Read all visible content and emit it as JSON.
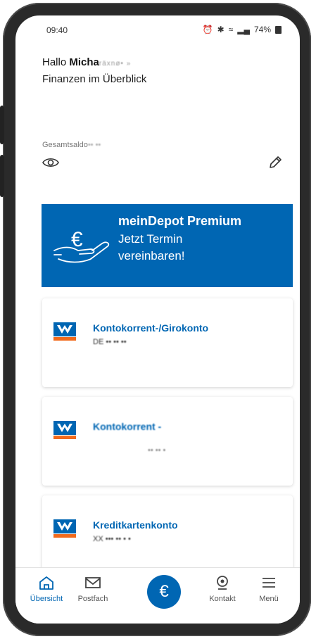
{
  "status": {
    "time": "09:40",
    "battery_pct": "74%"
  },
  "greeting": {
    "prefix": "Hallo",
    "name": "Micha",
    "name_blur": "räxnø• »"
  },
  "subtitle": "Finanzen im Überblick",
  "total": {
    "label": "Gesamtsaldo",
    "label_blur": "•• ••"
  },
  "promo": {
    "title": "meinDepot Premium",
    "line1": "Jetzt Termin",
    "line2": "vereinbaren!"
  },
  "accounts": [
    {
      "title": "Kontokorrent-/Girokonto",
      "subtitle": "DE •• •• ••"
    },
    {
      "title": "Kontokorrent -",
      "subtitle": "•• •• •"
    },
    {
      "title": "Kreditkartenkonto",
      "subtitle": "XX ••• •• • •"
    }
  ],
  "nav": {
    "overview": "Übersicht",
    "postfach": "Postfach",
    "center_symbol": "€",
    "kontakt": "Kontakt",
    "menu": "Menü"
  },
  "colors": {
    "brand_blue": "#0066b3",
    "logo_orange": "#f26b1d"
  }
}
